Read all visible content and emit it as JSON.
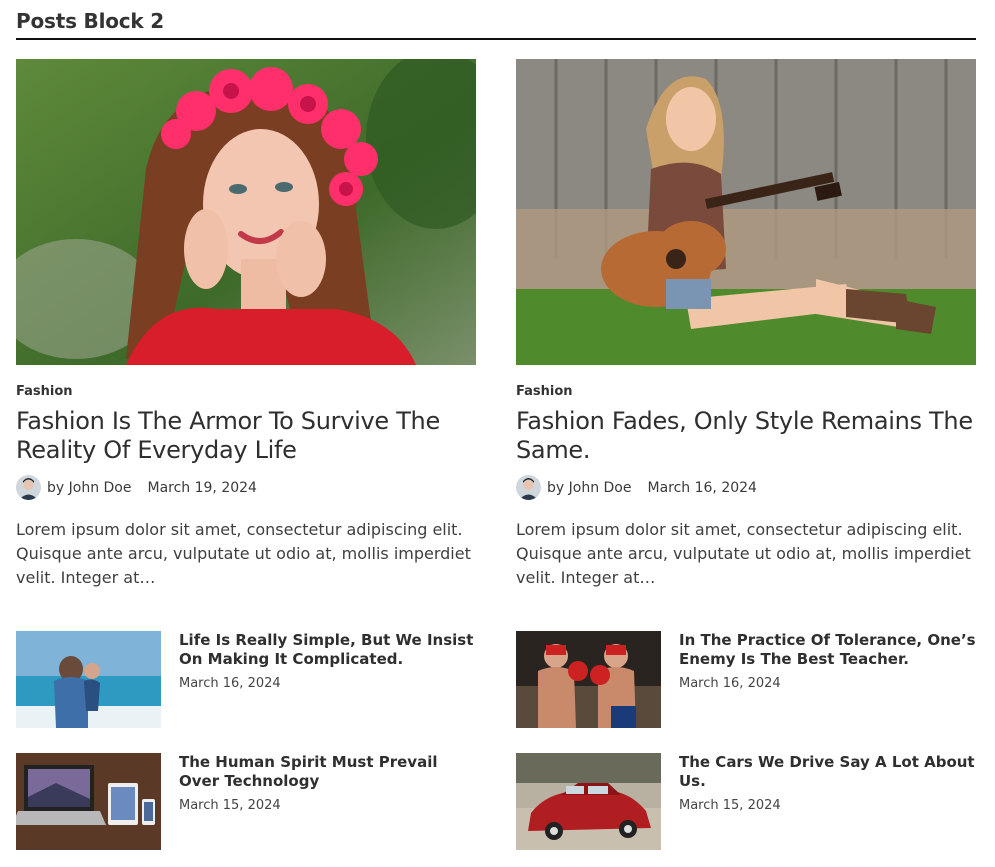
{
  "block": {
    "title": "Posts Block 2"
  },
  "featured": [
    {
      "category": "Fashion",
      "title": "Fashion Is The Armor To Survive The Reality Of Everyday Life",
      "author": "by John Doe",
      "date": "March 19, 2024",
      "excerpt": "Lorem ipsum dolor sit amet, consectetur adipiscing elit. Quisque ante arcu, vulputate ut odio at, mollis imperdiet velit. Integer at…"
    },
    {
      "category": "Fashion",
      "title": "Fashion Fades, Only Style Remains The Same.",
      "author": "by John Doe",
      "date": "March 16, 2024",
      "excerpt": "Lorem ipsum dolor sit amet, consectetur adipiscing elit. Quisque ante arcu, vulputate ut odio at, mollis imperdiet velit. Integer at…"
    }
  ],
  "list": [
    {
      "title": "Life Is Really Simple, But We Insist On Making It Complicated.",
      "date": "March 16, 2024"
    },
    {
      "title": "In The Practice Of Tolerance, One’s Enemy Is The Best Teacher.",
      "date": "March 16, 2024"
    },
    {
      "title": "The Human Spirit Must Prevail Over Technology",
      "date": "March 15, 2024"
    },
    {
      "title": "The Cars We Drive Say A Lot About Us.",
      "date": "March 15, 2024"
    }
  ]
}
